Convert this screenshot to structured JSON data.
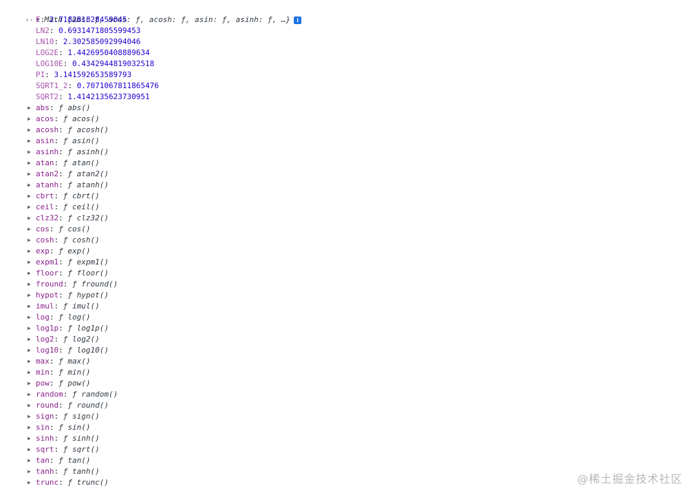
{
  "header": {
    "return_arrow": "‹·",
    "expand_arrow": "▼",
    "preview": "Math {abs: ƒ, acos: ƒ, acosh: ƒ, asin: ƒ, asinh: ƒ, …}",
    "info_icon": "i"
  },
  "constants": [
    {
      "key": "E",
      "value": "2.718281828459045"
    },
    {
      "key": "LN2",
      "value": "0.6931471805599453"
    },
    {
      "key": "LN10",
      "value": "2.302585092994046"
    },
    {
      "key": "LOG2E",
      "value": "1.4426950408889634"
    },
    {
      "key": "LOG10E",
      "value": "0.4342944819032518"
    },
    {
      "key": "PI",
      "value": "3.141592653589793"
    },
    {
      "key": "SQRT1_2",
      "value": "0.7071067811865476"
    },
    {
      "key": "SQRT2",
      "value": "1.4142135623730951"
    }
  ],
  "functions": [
    {
      "key": "abs",
      "value": "ƒ abs()"
    },
    {
      "key": "acos",
      "value": "ƒ acos()"
    },
    {
      "key": "acosh",
      "value": "ƒ acosh()"
    },
    {
      "key": "asin",
      "value": "ƒ asin()"
    },
    {
      "key": "asinh",
      "value": "ƒ asinh()"
    },
    {
      "key": "atan",
      "value": "ƒ atan()"
    },
    {
      "key": "atan2",
      "value": "ƒ atan2()"
    },
    {
      "key": "atanh",
      "value": "ƒ atanh()"
    },
    {
      "key": "cbrt",
      "value": "ƒ cbrt()"
    },
    {
      "key": "ceil",
      "value": "ƒ ceil()"
    },
    {
      "key": "clz32",
      "value": "ƒ clz32()"
    },
    {
      "key": "cos",
      "value": "ƒ cos()"
    },
    {
      "key": "cosh",
      "value": "ƒ cosh()"
    },
    {
      "key": "exp",
      "value": "ƒ exp()"
    },
    {
      "key": "expm1",
      "value": "ƒ expm1()"
    },
    {
      "key": "floor",
      "value": "ƒ floor()"
    },
    {
      "key": "fround",
      "value": "ƒ fround()"
    },
    {
      "key": "hypot",
      "value": "ƒ hypot()"
    },
    {
      "key": "imul",
      "value": "ƒ imul()"
    },
    {
      "key": "log",
      "value": "ƒ log()"
    },
    {
      "key": "log1p",
      "value": "ƒ log1p()"
    },
    {
      "key": "log2",
      "value": "ƒ log2()"
    },
    {
      "key": "log10",
      "value": "ƒ log10()"
    },
    {
      "key": "max",
      "value": "ƒ max()"
    },
    {
      "key": "min",
      "value": "ƒ min()"
    },
    {
      "key": "pow",
      "value": "ƒ pow()"
    },
    {
      "key": "random",
      "value": "ƒ random()"
    },
    {
      "key": "round",
      "value": "ƒ round()"
    },
    {
      "key": "sign",
      "value": "ƒ sign()"
    },
    {
      "key": "sin",
      "value": "ƒ sin()"
    },
    {
      "key": "sinh",
      "value": "ƒ sinh()"
    },
    {
      "key": "sqrt",
      "value": "ƒ sqrt()"
    },
    {
      "key": "tan",
      "value": "ƒ tan()"
    },
    {
      "key": "tanh",
      "value": "ƒ tanh()"
    },
    {
      "key": "trunc",
      "value": "ƒ trunc()"
    }
  ],
  "collapsed_arrow": "▶",
  "watermark": "@稀土掘金技术社区"
}
